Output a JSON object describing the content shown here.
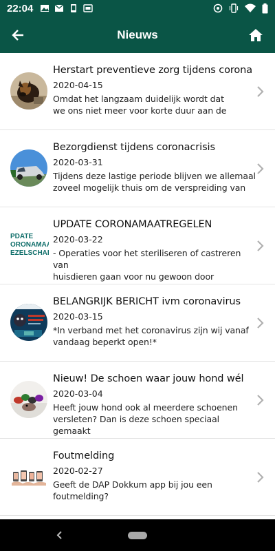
{
  "status_bar": {
    "time": "22:04",
    "left_icons": [
      "image-icon",
      "mail-icon",
      "phone-icon",
      "cast-icon"
    ],
    "right_icons": [
      "sync-icon",
      "vibrate-icon",
      "wifi-icon",
      "battery-icon"
    ]
  },
  "app_bar": {
    "title": "Nieuws",
    "back_icon": "arrow-left-icon",
    "home_icon": "home-icon"
  },
  "colors": {
    "primary": "#0a5546",
    "chevron": "#b0b0b0"
  },
  "news": [
    {
      "title": "Herstart preventieve zorg tijdens corona",
      "date": "2020-04-15",
      "desc_line1": "Omdat het langzaam duidelijk wordt dat",
      "desc_line2": "we ons niet meer voor korte duur aan de",
      "thumb": "dog-photo"
    },
    {
      "title": "Bezorgdienst tijdens coronacrisis",
      "date": "2020-03-31",
      "desc_line1": "Tijdens deze lastige periode blijven we allemaal",
      "desc_line2": "zoveel mogelijk thuis om de verspreiding van",
      "thumb": "car-photo"
    },
    {
      "title": "UPDATE CORONAMAATREGELEN",
      "date": "2020-03-22",
      "desc_line1": "- Operaties voor het steriliseren of castreren van",
      "desc_line2": "huisdieren gaan voor nu gewoon door",
      "thumb": "update-text-image",
      "thumb_text": [
        "PDATE",
        "ORONAMAA",
        "EZELSCHAP"
      ]
    },
    {
      "title": "BELANGRIJK BERICHT ivm coronavirus",
      "date": "2020-03-15",
      "desc_line1": "*In verband met het coronavirus zijn wij vanaf",
      "desc_line2": "vandaag beperkt open!*",
      "thumb": "poster-image"
    },
    {
      "title": "Nieuw! De schoen waar jouw hond wél",
      "date": "2020-03-04",
      "desc_line1": "Heeft jouw hond ook al meerdere schoenen",
      "desc_line2": "versleten? Dan is deze schoen speciaal gemaakt",
      "thumb": "shoes-photo"
    },
    {
      "title": "Foutmelding",
      "date": "2020-02-27",
      "desc_line1": "Geeft de DAP Dokkum app bij jou een",
      "desc_line2": "foutmelding?",
      "thumb": "phones-image"
    }
  ]
}
